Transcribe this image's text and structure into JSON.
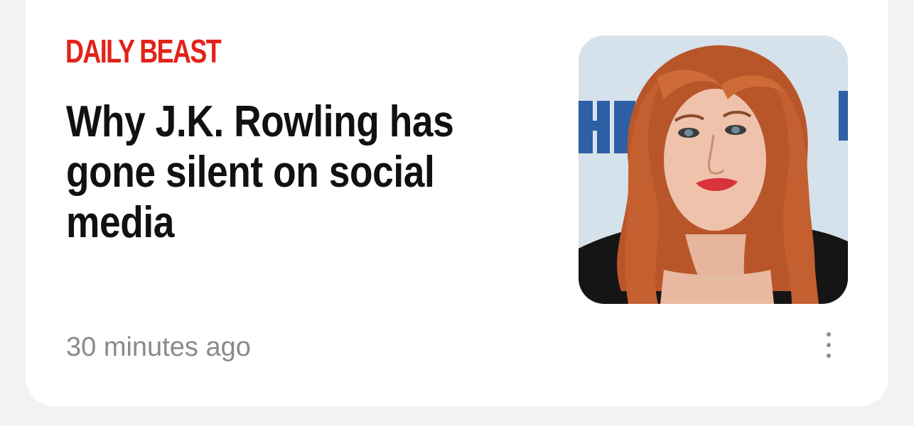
{
  "article": {
    "source": "DAILY BEAST",
    "headline": "Why J.K. Rowling has gone silent on social media",
    "timestamp": "30 minutes ago",
    "thumbnail_alt": "Portrait photo of J.K. Rowling"
  },
  "colors": {
    "source": "#e2231a",
    "headline": "#111111",
    "timestamp": "#8a8a8a",
    "card": "#ffffff",
    "background": "#f2f2f4"
  },
  "icons": {
    "more": "more-vertical-icon"
  }
}
